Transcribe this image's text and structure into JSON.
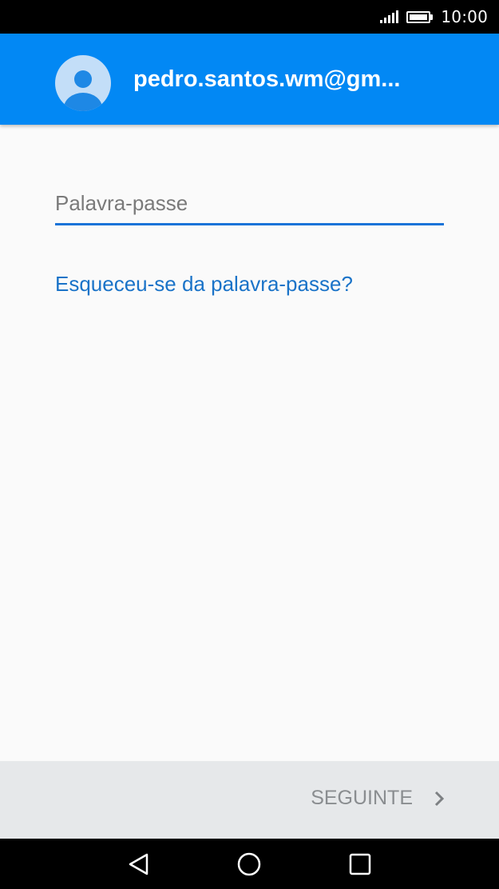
{
  "status_bar": {
    "time": "10:00",
    "icons": [
      "signal-icon",
      "battery-icon"
    ]
  },
  "header": {
    "avatar_icon": "person-avatar-icon",
    "email": "pedro.santos.wm@gm..."
  },
  "password": {
    "placeholder": "Palavra-passe",
    "value": ""
  },
  "forgot_link": "Esqueceu-se da palavra-passe?",
  "action_bar": {
    "next_label": "SEGUINTE",
    "next_icon": "chevron-right-icon"
  },
  "nav_bar": {
    "icons": [
      "back-icon",
      "home-icon",
      "recent-apps-icon"
    ]
  },
  "colors": {
    "header": "#0288f4",
    "accent": "#1a73d8",
    "link": "#1a73c8",
    "action_bar": "#e6e8ea",
    "disabled_text": "#8a8d90"
  }
}
